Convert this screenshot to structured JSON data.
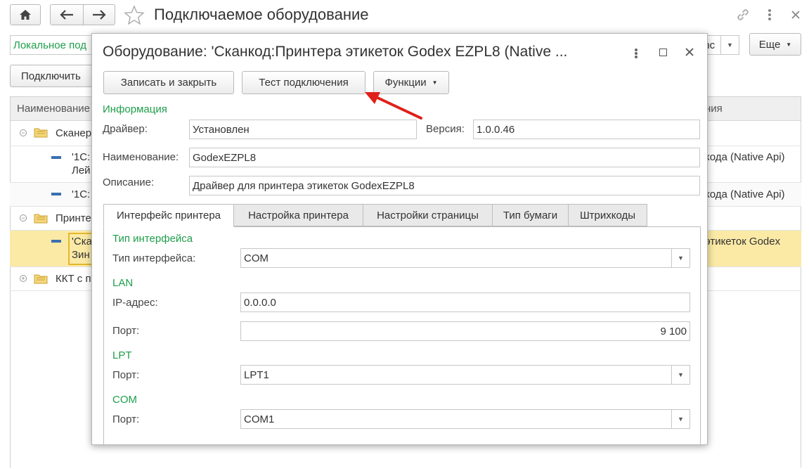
{
  "window": {
    "title": "Подключаемое оборудование",
    "filter_value": "Локальное под",
    "more_label": "Еще",
    "connect_label": "Подключить",
    "partial_field": "anc",
    "columns": {
      "name": "Наименование",
      "right": "ния"
    },
    "tree": [
      {
        "label": "Сканер",
        "type": "group"
      },
      {
        "label": "'1С:",
        "label2": "Лей",
        "right": "кода (Native Api)"
      },
      {
        "label": "'1С:",
        "right": "кода (Native Api)"
      },
      {
        "label": "Принте",
        "type": "group"
      },
      {
        "label": "'Ска",
        "label2": "Зин",
        "right": "этикеток Godex"
      },
      {
        "label": "ККТ с п",
        "type": "group"
      }
    ]
  },
  "dialog": {
    "title": "Оборудование: 'Сканкод:Принтера этикеток Godex EZPL8 (Native ...",
    "save_close_label": "Записать и закрыть",
    "test_label": "Тест подключения",
    "functions_label": "Функции",
    "info_header": "Информация",
    "driver_label": "Драйвер:",
    "driver_value": "Установлен",
    "version_label": "Версия:",
    "version_value": "1.0.0.46",
    "name_label": "Наименование:",
    "name_value": "GodexEZPL8",
    "desc_label": "Описание:",
    "desc_value": "Драйвер для принтера этикеток GodexEZPL8",
    "tabs": [
      "Интерфейс принтера",
      "Настройка принтера",
      "Настройки страницы",
      "Тип бумаги",
      "Штрихкоды"
    ],
    "iface_header": "Тип интерфейса",
    "iface_label": "Тип интерфейса:",
    "iface_value": "COM",
    "lan_header": "LAN",
    "ip_label": "IP-адрес:",
    "ip_value": "0.0.0.0",
    "port_label": "Порт:",
    "lan_port_value": "9 100",
    "lpt_header": "LPT",
    "lpt_port_value": "LPT1",
    "com_header": "COM",
    "com_port_value": "COM1"
  },
  "colors": {
    "accent_green": "#1e9e4a",
    "selected_row": "#fbeaa6",
    "arrow_red": "#e0201b"
  }
}
